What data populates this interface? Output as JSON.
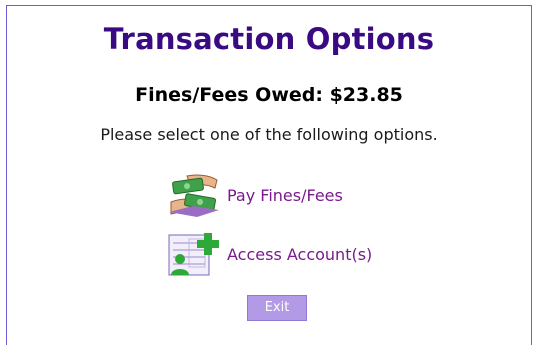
{
  "page": {
    "title": "Transaction Options",
    "fines_owed": "Fines/Fees Owed: $23.85",
    "instruction": "Please select one of the following options."
  },
  "options": [
    {
      "label": "Pay Fines/Fees",
      "icon": "money-hands-icon"
    },
    {
      "label": "Access Account(s)",
      "icon": "account-ledger-icon"
    }
  ],
  "exit_button": {
    "label": "Exit"
  },
  "colors": {
    "title": "#3a0a82",
    "link": "#7a1a8e",
    "border": "#6a5fd0",
    "exit_button_bg": "#b39ae6"
  }
}
